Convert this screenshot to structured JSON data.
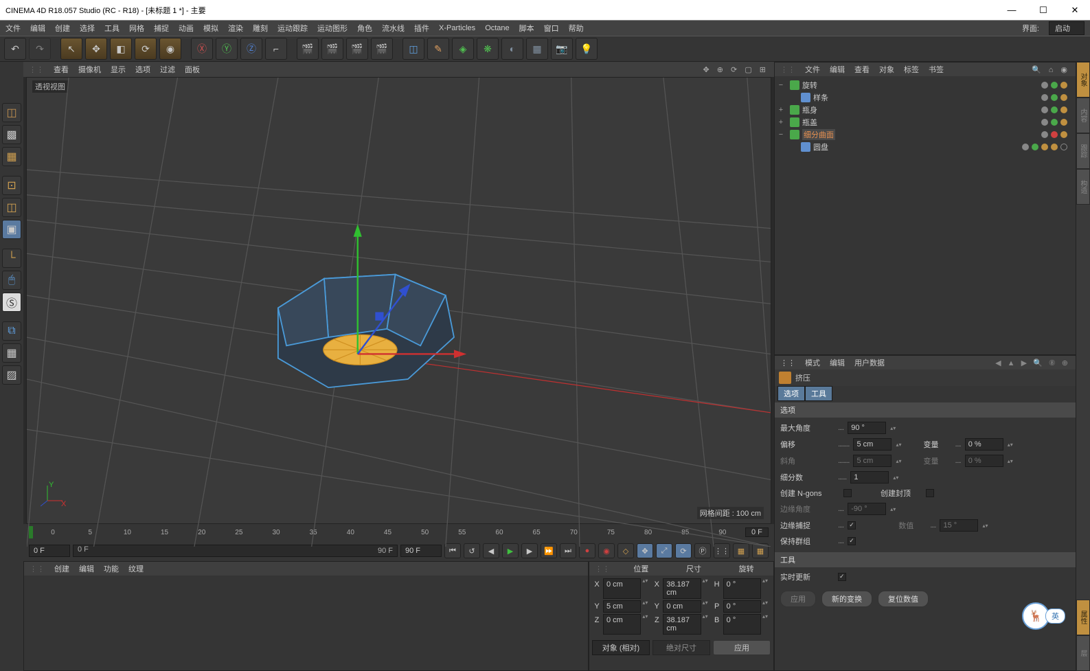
{
  "window": {
    "title": "CINEMA 4D R18.057 Studio (RC - R18) - [未标题 1 *] - 主要"
  },
  "menu": {
    "items": [
      "文件",
      "编辑",
      "创建",
      "选择",
      "工具",
      "网格",
      "捕捉",
      "动画",
      "模拟",
      "渲染",
      "雕刻",
      "运动跟踪",
      "运动图形",
      "角色",
      "流水线",
      "插件",
      "X-Particles",
      "Octane",
      "脚本",
      "窗口",
      "帮助"
    ],
    "layout_label": "界面:",
    "layout_value": "启动"
  },
  "viewport": {
    "menu": [
      "查看",
      "摄像机",
      "显示",
      "选项",
      "过滤",
      "面板"
    ],
    "label": "透视视图",
    "grid_info": "网格间距 : 100 cm"
  },
  "timeline": {
    "ticks": [
      "0",
      "5",
      "10",
      "15",
      "20",
      "25",
      "30",
      "35",
      "40",
      "45",
      "50",
      "55",
      "60",
      "65",
      "70",
      "75",
      "80",
      "85",
      "90"
    ],
    "end": "0 F"
  },
  "playbar": {
    "start": "0 F",
    "cur": "0 F",
    "range_end": "90 F",
    "end": "90 F"
  },
  "material": {
    "menu": [
      "创建",
      "编辑",
      "功能",
      "纹理"
    ]
  },
  "coord": {
    "menu": [
      "位置",
      "尺寸",
      "旋转"
    ],
    "rows": [
      {
        "a": "X",
        "av": "0 cm",
        "b": "X",
        "bv": "38.187 cm",
        "c": "H",
        "cv": "0 °"
      },
      {
        "a": "Y",
        "av": "5 cm",
        "b": "Y",
        "bv": "0 cm",
        "c": "P",
        "cv": "0 °"
      },
      {
        "a": "Z",
        "av": "0 cm",
        "b": "Z",
        "bv": "38.187 cm",
        "c": "B",
        "cv": "0 °"
      }
    ],
    "mode1": "对象 (相对)",
    "mode2": "绝对尺寸",
    "apply": "应用"
  },
  "objects": {
    "menu": [
      "文件",
      "编辑",
      "查看",
      "对象",
      "标签",
      "书签"
    ],
    "tree": [
      {
        "exp": "−",
        "depth": 0,
        "icon": "spin",
        "color": "#4aa84a",
        "name": "旋转"
      },
      {
        "exp": "",
        "depth": 1,
        "icon": "spline",
        "color": "#6090d0",
        "name": "样条"
      },
      {
        "exp": "+",
        "depth": 0,
        "icon": "obj",
        "color": "#4aa84a",
        "name": "瓶身"
      },
      {
        "exp": "+",
        "depth": 0,
        "icon": "obj",
        "color": "#4aa84a",
        "name": "瓶盖"
      },
      {
        "exp": "−",
        "depth": 0,
        "icon": "sds",
        "color": "#4aa84a",
        "name": "细分曲面",
        "sel": true,
        "xtag": true
      },
      {
        "exp": "",
        "depth": 1,
        "icon": "disc",
        "color": "#6090d0",
        "name": "圆盘",
        "extra": true
      }
    ]
  },
  "attr": {
    "menu": [
      "模式",
      "编辑",
      "用户数据"
    ],
    "title": "挤压",
    "tabs": [
      "选项",
      "工具"
    ],
    "section1": "选项",
    "rows": [
      {
        "label": "最大角度",
        "value": "90 °"
      },
      {
        "label": "偏移",
        "value": "5 cm",
        "label2": "变量",
        "value2": "0 %"
      },
      {
        "label": "斜角",
        "value": "5 cm",
        "dim": true,
        "label2": "变量",
        "value2": "0 %",
        "dim2": true
      },
      {
        "label": "细分数",
        "value": "1"
      }
    ],
    "checks1": [
      {
        "label": "创建 N-gons",
        "on": false
      },
      {
        "label": "创建封顶",
        "on": false
      }
    ],
    "rows2": [
      {
        "label": "边缘角度",
        "value": "-90 °",
        "dim": true
      },
      {
        "label": "边缘捕捉",
        "check": true,
        "label2": "数值",
        "value2": "15 °",
        "dim2": true
      },
      {
        "label": "保持群组",
        "check": true
      }
    ],
    "section2": "工具",
    "realtime": "实时更新",
    "buttons": [
      "应用",
      "新的变换",
      "复位数值"
    ]
  },
  "ime": {
    "lang": "英"
  }
}
